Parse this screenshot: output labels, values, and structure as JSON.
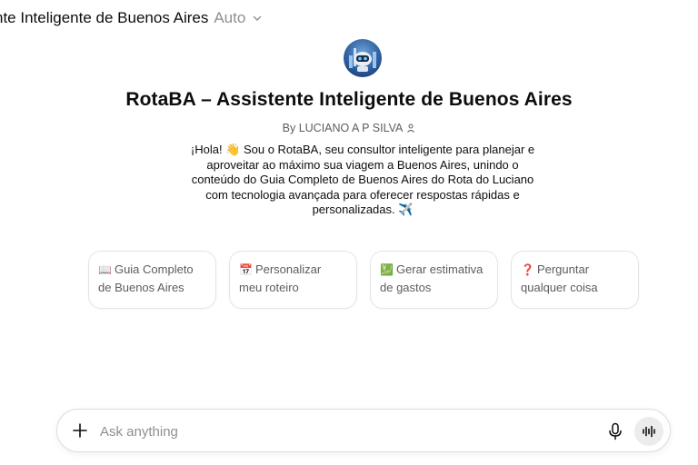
{
  "header": {
    "title": "nte Inteligente de Buenos Aires",
    "mode": "Auto"
  },
  "gpt": {
    "name": "RotaBA – Assistente Inteligente de Buenos Aires",
    "author": "By LUCIANO A P SILVA",
    "description": "¡Hola! 👋 Sou o RotaBA, seu consultor inteligente para planejar e aproveitar ao máximo sua viagem a Buenos Aires, unindo o conteúdo do Guia Completo de Buenos Aires do Rota do Luciano com tecnologia avançada para oferecer respostas rápidas e personalizadas. ✈️"
  },
  "starters": [
    {
      "icon": "📖",
      "label": "Guia Completo de Buenos Aires"
    },
    {
      "icon": "📅",
      "label": "Personalizar meu roteiro"
    },
    {
      "icon": "💹",
      "label": "Gerar estimativa de gastos"
    },
    {
      "icon": "❓",
      "label": "Perguntar qualquer coisa"
    }
  ],
  "composer": {
    "placeholder": "Ask anything"
  },
  "icons": [
    "chevron-down-icon",
    "avatar",
    "person-icon",
    "plus-icon",
    "microphone-icon",
    "voice-wave-icon"
  ]
}
